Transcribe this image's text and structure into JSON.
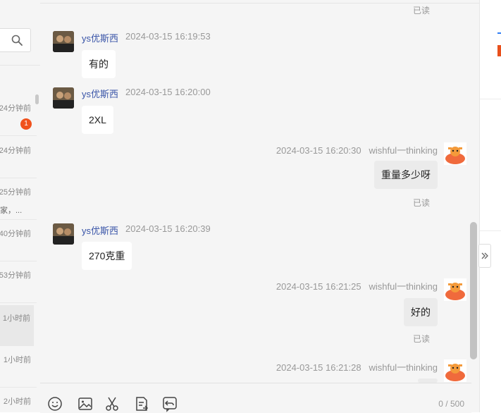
{
  "sidebar": {
    "search_icon": "search-icon",
    "conversations": [
      {
        "time": "24分钟前",
        "preview": "",
        "badge": "1",
        "active": false
      },
      {
        "time": "24分钟前",
        "preview": "",
        "badge": "",
        "active": false
      },
      {
        "time": "25分钟前",
        "preview": "家，...",
        "badge": "",
        "active": false
      },
      {
        "time": "40分钟前",
        "preview": "",
        "badge": "",
        "active": false
      },
      {
        "time": "53分钟前",
        "preview": "",
        "badge": "",
        "active": false
      },
      {
        "time": "1小时前",
        "preview": "",
        "badge": "",
        "active": true
      },
      {
        "time": "1小时前",
        "preview": "",
        "badge": "",
        "active": false
      },
      {
        "time": "2小时前",
        "preview": "",
        "badge": "",
        "active": false
      }
    ]
  },
  "chat": {
    "top_read": "已读",
    "messages": [
      {
        "from": "customer",
        "name": "ys优斯西",
        "time": "2024-03-15 16:19:53",
        "text": "有的"
      },
      {
        "from": "customer",
        "name": "ys优斯西",
        "time": "2024-03-15 16:20:00",
        "text": "2XL"
      },
      {
        "from": "self",
        "name": "wishful一thinking",
        "time": "2024-03-15 16:20:30",
        "text": "重量多少呀",
        "status": "已读"
      },
      {
        "from": "customer",
        "name": "ys优斯西",
        "time": "2024-03-15 16:20:39",
        "text": "270克重"
      },
      {
        "from": "self",
        "name": "wishful一thinking",
        "time": "2024-03-15 16:21:25",
        "text": "好的",
        "status": "已读"
      },
      {
        "from": "self",
        "name": "wishful一thinking",
        "time": "2024-03-15 16:21:28",
        "text": ""
      }
    ]
  },
  "input": {
    "tools": [
      "emoji-icon",
      "image-icon",
      "scissors-icon",
      "note-icon",
      "return-icon"
    ],
    "counter": "0 / 500"
  },
  "colors": {
    "accent": "#2f7ef5",
    "badge": "#f0521d",
    "name": "#3a55a8"
  }
}
